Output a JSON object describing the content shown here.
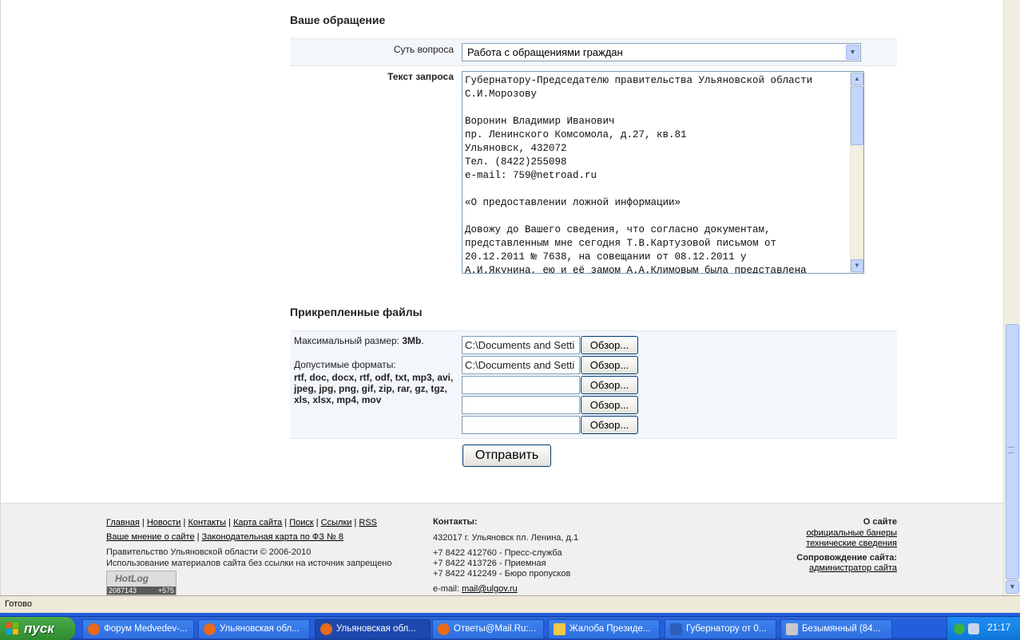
{
  "form": {
    "section_title": "Ваше обращение",
    "topic_label": "Суть вопроса",
    "topic_value": "Работа с обращениями граждан",
    "text_label": "Текст запроса",
    "text_value": "Губернатору-Председателю правительства Ульяновской области\nС.И.Морозову\n\nВоронин Владимир Иванович\nпр. Ленинского Комсомола, д.27, кв.81\nУльяновск, 432072\nТел. (8422)255098\ne-mail: 759@netroad.ru\n\n«О предоставлении ложной информации»\n\nДовожу до Вашего сведения, что согласно документам,\nпредставленным мне сегодня Т.В.Картузовой письмом от\n20.12.2011 № 7638, на совещании от 08.12.2011 у\nА.И.Якунина, ею и её замом А.А.Климовым была представлена"
  },
  "attachments": {
    "section_title": "Прикрепленные файлы",
    "max_size_label": "Максимальный размер:",
    "max_size_value": "3Mb",
    "max_size_suffix": ".",
    "formats_label": "Допустимые форматы:",
    "formats_value": "rtf, doc, docx, rtf, odf, txt, mp3, avi, jpeg, jpg, png, gif, zip, rar, gz, tgz, xls, xlsx, mp4, mov",
    "browse_label": "Обзор...",
    "files": [
      {
        "value": "C:\\Documents and Setti"
      },
      {
        "value": "C:\\Documents and Setti"
      },
      {
        "value": ""
      },
      {
        "value": ""
      },
      {
        "value": ""
      }
    ],
    "submit_label": "Отправить"
  },
  "footer": {
    "links_row1": [
      "Главная",
      "Новости",
      "Контакты",
      "Карта сайта",
      "Поиск",
      "Ссылки",
      "RSS"
    ],
    "links_row2": [
      "Ваше мнение о сайте",
      "Законодательная карта по ФЗ № 8"
    ],
    "copyright": "Правительство Ульяновской области © 2006-2010",
    "notice": "Использование материалов сайта без ссылки на источник запрещено",
    "counter_brand": "HotLog",
    "counter_total": "2087143",
    "counter_delta": "+575",
    "contacts_title": "Контакты:",
    "address": "432017 г. Ульяновск пл. Ленина, д.1",
    "phone1": "+7 8422 412760 - Пресс-служба",
    "phone2": "+7 8422 413726 - Приемная",
    "phone3": "+7 8422 412249 - Бюро пропусков",
    "email_label": "e-mail:",
    "email_value": "mail@ulgov.ru",
    "about_title": "О сайте",
    "about_link1": "официальные банеры",
    "about_link2": "технические сведения",
    "support_title": "Сопровождение сайта:",
    "support_link": "администратор сайта"
  },
  "statusbar": {
    "text": "Готово"
  },
  "taskbar": {
    "start_label": "пуск",
    "tasks": [
      {
        "label": "Форум Medvedev-...",
        "color": "#e86a1a"
      },
      {
        "label": "Ульяновская обл...",
        "color": "#e86a1a"
      },
      {
        "label": "Ульяновская обл...",
        "color": "#e86a1a"
      },
      {
        "label": "Ответы@Mail.Ru:...",
        "color": "#e86a1a"
      },
      {
        "label": "Жалоба Президе...",
        "color": "#f0c84a"
      },
      {
        "label": "Губернатору от 0...",
        "color": "#2f5fb8"
      },
      {
        "label": "Безымянный (84...",
        "color": "#c8c8c8"
      }
    ],
    "clock": "21:17"
  }
}
